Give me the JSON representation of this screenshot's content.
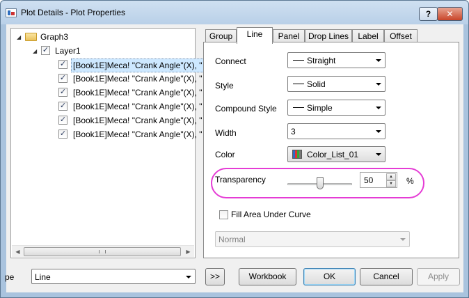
{
  "window": {
    "title": "Plot Details - Plot Properties",
    "help_label": "?",
    "close_label": "✕"
  },
  "tree": {
    "root_label": "Graph3",
    "layer_label": "Layer1",
    "plots": [
      "[Book1E]Meca! \"Crank Angle\"(X), \"",
      "[Book1E]Meca! \"Crank Angle\"(X), \"",
      "[Book1E]Meca! \"Crank Angle\"(X), \"",
      "[Book1E]Meca! \"Crank Angle\"(X), \"",
      "[Book1E]Meca! \"Crank Angle\"(X), \"",
      "[Book1E]Meca! \"Crank Angle\"(X), \""
    ],
    "check_mark": "✓",
    "expand_glyph": "◢"
  },
  "tabs": [
    "Group",
    "Line",
    "Panel",
    "Drop Lines",
    "Label",
    "Offset"
  ],
  "active_tab": "Line",
  "line_tab": {
    "connect_label": "Connect",
    "connect_value": "Straight",
    "style_label": "Style",
    "style_value": "Solid",
    "compound_label": "Compound Style",
    "compound_value": "Simple",
    "width_label": "Width",
    "width_value": "3",
    "color_label": "Color",
    "color_value": "Color_List_01",
    "transparency_label": "Transparency",
    "transparency_value": "50",
    "transparency_unit": "%",
    "transparency_level": 0.5,
    "fill_label": "Fill Area Under Curve",
    "fill_checked": false,
    "fill_mode_value": "Normal"
  },
  "bottom": {
    "type_label": "pe",
    "type_value": "Line",
    "expand_label": ">>",
    "workbook_label": "Workbook",
    "ok_label": "OK",
    "cancel_label": "Cancel",
    "apply_label": "Apply"
  },
  "colors": {
    "highlight": "#e53cd5",
    "selection": "#cde8ff"
  }
}
